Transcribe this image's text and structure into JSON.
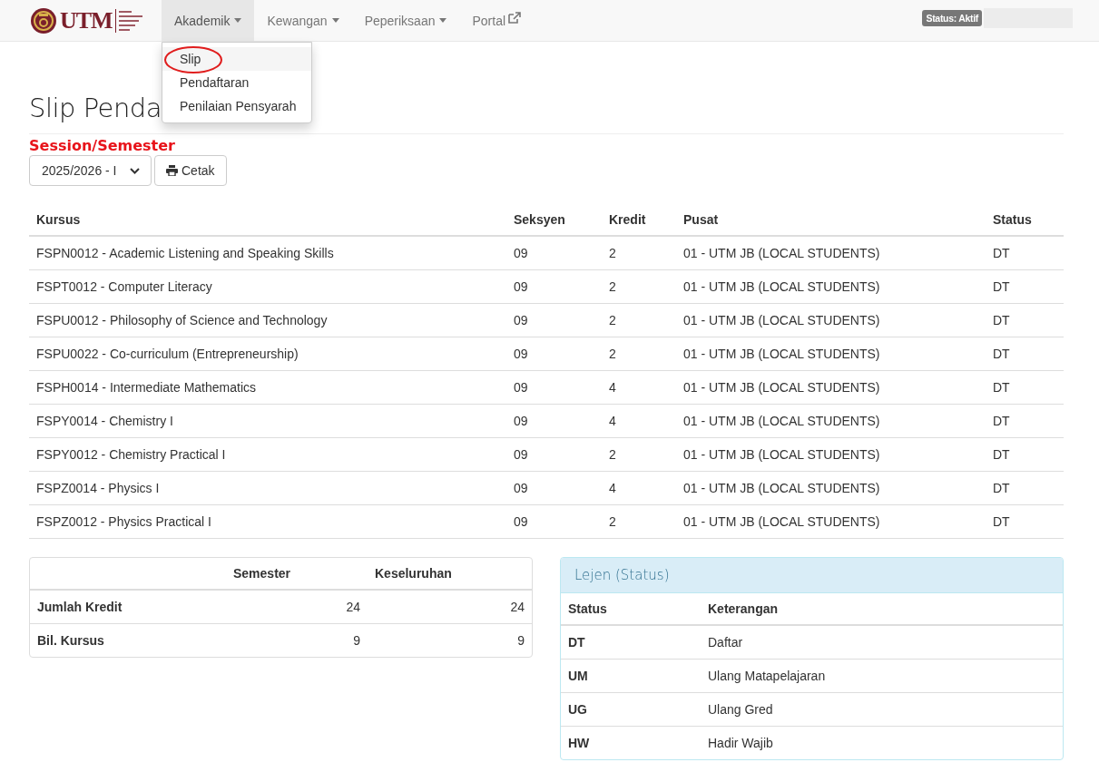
{
  "navbar": {
    "logo_text": "UTM",
    "menu": [
      {
        "label": "Akademik",
        "kind": "dropdown",
        "selected": true
      },
      {
        "label": "Kewangan",
        "kind": "dropdown",
        "selected": false
      },
      {
        "label": "Peperiksaan",
        "kind": "dropdown",
        "selected": false
      },
      {
        "label": "Portal",
        "kind": "external",
        "selected": false
      }
    ],
    "status_badge": "Status: Aktif"
  },
  "dropdown": {
    "items": [
      {
        "label": "Slip",
        "selected": true,
        "circled": true
      },
      {
        "label": "Pendaftaran",
        "selected": false,
        "circled": false
      },
      {
        "label": "Penilaian Pensyarah",
        "selected": false,
        "circled": false
      }
    ]
  },
  "page_title": "Slip Penda",
  "session_label": "Session/Semester",
  "session_select": {
    "value": "2025/2026 - I"
  },
  "print_button": "Cetak",
  "courses": {
    "columns": [
      "Kursus",
      "Seksyen",
      "Kredit",
      "Pusat",
      "Status"
    ],
    "rows": [
      [
        "FSPN0012 - Academic Listening and Speaking Skills",
        "09",
        "2",
        "01 - UTM JB (LOCAL STUDENTS)",
        "DT"
      ],
      [
        "FSPT0012 - Computer Literacy",
        "09",
        "2",
        "01 - UTM JB (LOCAL STUDENTS)",
        "DT"
      ],
      [
        "FSPU0012 - Philosophy of Science and Technology",
        "09",
        "2",
        "01 - UTM JB (LOCAL STUDENTS)",
        "DT"
      ],
      [
        "FSPU0022 - Co-curriculum (Entrepreneurship)",
        "09",
        "2",
        "01 - UTM JB (LOCAL STUDENTS)",
        "DT"
      ],
      [
        "FSPH0014 - Intermediate Mathematics",
        "09",
        "4",
        "01 - UTM JB (LOCAL STUDENTS)",
        "DT"
      ],
      [
        "FSPY0014 - Chemistry I",
        "09",
        "4",
        "01 - UTM JB (LOCAL STUDENTS)",
        "DT"
      ],
      [
        "FSPY0012 - Chemistry Practical I",
        "09",
        "2",
        "01 - UTM JB (LOCAL STUDENTS)",
        "DT"
      ],
      [
        "FSPZ0014 - Physics I",
        "09",
        "4",
        "01 - UTM JB (LOCAL STUDENTS)",
        "DT"
      ],
      [
        "FSPZ0012 - Physics Practical I",
        "09",
        "2",
        "01 - UTM JB (LOCAL STUDENTS)",
        "DT"
      ]
    ]
  },
  "summary": {
    "columns": [
      "Semester",
      "Keseluruhan"
    ],
    "rows": [
      {
        "label": "Jumlah Kredit",
        "semester": "24",
        "overall": "24"
      },
      {
        "label": "Bil. Kursus",
        "semester": "9",
        "overall": "9"
      }
    ]
  },
  "legend": {
    "title": "Lejen (Status)",
    "columns": [
      "Status",
      "Keterangan"
    ],
    "rows": [
      [
        "DT",
        "Daftar"
      ],
      [
        "UM",
        "Ulang Matapelajaran"
      ],
      [
        "UG",
        "Ulang Gred"
      ],
      [
        "HW",
        "Hadir Wajib"
      ]
    ]
  }
}
